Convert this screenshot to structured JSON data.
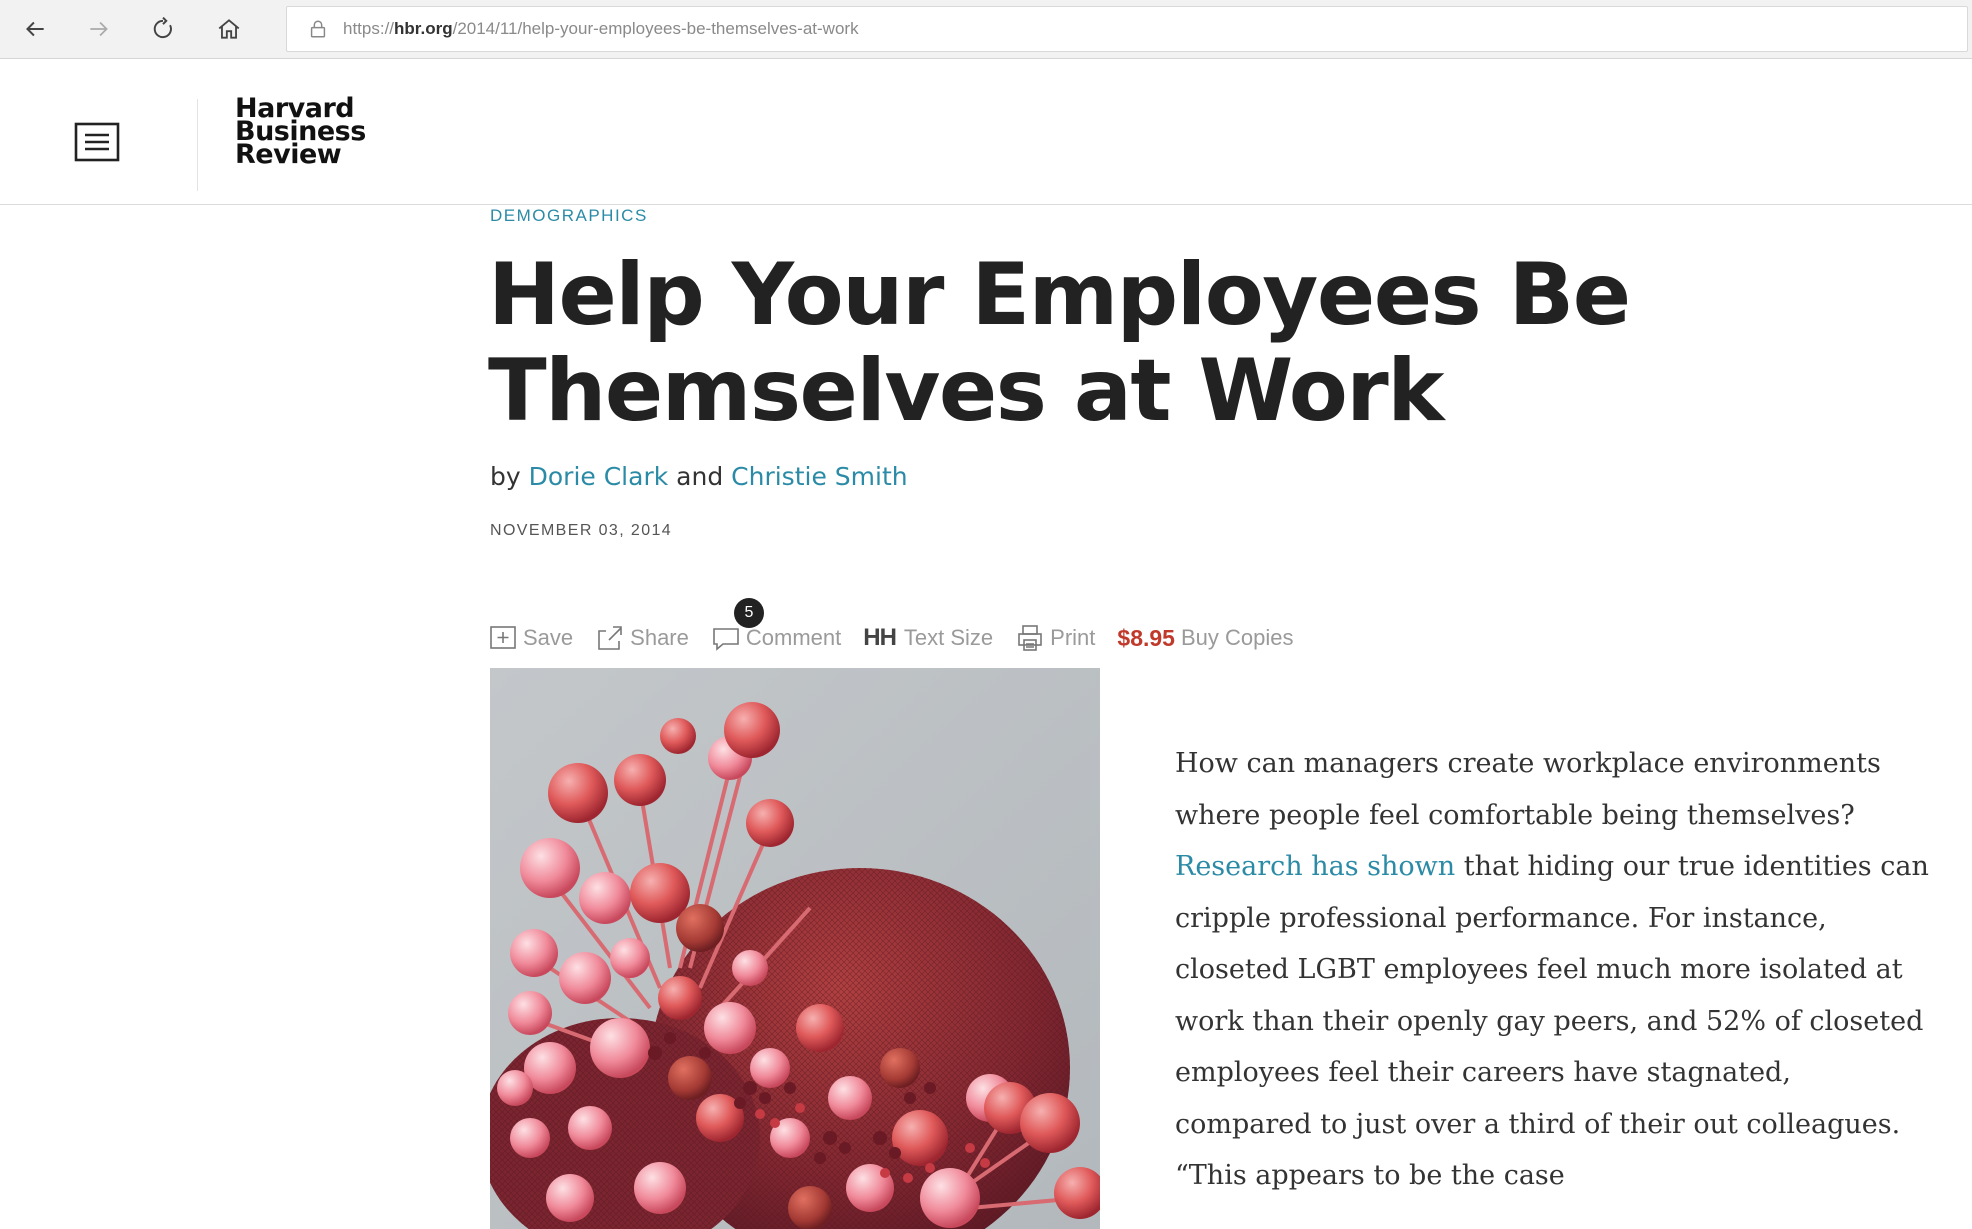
{
  "browser": {
    "url_prefix": "https://",
    "url_domain": "hbr.org",
    "url_path": "/2014/11/help-your-employees-be-themselves-at-work"
  },
  "header": {
    "logo_line1": "Harvard",
    "logo_line2": "Business",
    "logo_line3": "Review"
  },
  "article": {
    "category": "DEMOGRAPHICS",
    "title_line1": "Help Your Employees Be",
    "title_line2": "Themselves at Work",
    "by": "by",
    "author1": "Dorie Clark",
    "and": "and",
    "author2": "Christie Smith",
    "date": "NOVEMBER 03, 2014"
  },
  "toolbar": {
    "save": "Save",
    "share": "Share",
    "comment_count": "5",
    "comment": "Comment",
    "text_size_icon": "HH",
    "text_size": "Text Size",
    "print": "Print",
    "price": "$8.95",
    "buy": "Buy Copies"
  },
  "body": {
    "p1_a": "How can managers create workplace environments where people feel comfortable being themselves?",
    "p1_link": "Research has shown",
    "p1_b": "that hiding our true identities can cripple professional performance. For instance, closeted LGBT employees feel much more isolated at work than their openly gay peers, and 52% of closeted employees feel their careers have stagnated, compared to just over a third of their out colleagues. “This appears to be the case"
  },
  "colors": {
    "accent": "#2b8ba6",
    "price": "#c0392b",
    "text": "#222222"
  },
  "icons": {
    "back": "arrow-left-icon",
    "forward": "arrow-right-icon",
    "refresh": "refresh-icon",
    "home": "home-icon",
    "lock": "lock-icon",
    "menu": "menu-icon",
    "save": "save-icon",
    "share": "share-icon",
    "comment": "comment-icon",
    "print": "print-icon"
  }
}
